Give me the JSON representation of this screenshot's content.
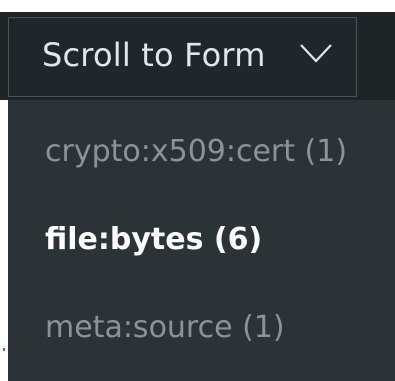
{
  "dropdown": {
    "label": "Scroll to Form",
    "icon": "chevron-down-icon"
  },
  "menu": {
    "items": [
      {
        "label": "crypto:x509:cert (1)",
        "state": "dim"
      },
      {
        "label": "file:bytes (6)",
        "state": "active"
      },
      {
        "label": "meta:source (1)",
        "state": "dim"
      }
    ]
  },
  "colors": {
    "bar_bg": "#1f2427",
    "menu_bg": "#2c3337",
    "active_text": "#ffffff",
    "dim_text": "#8c9396"
  }
}
